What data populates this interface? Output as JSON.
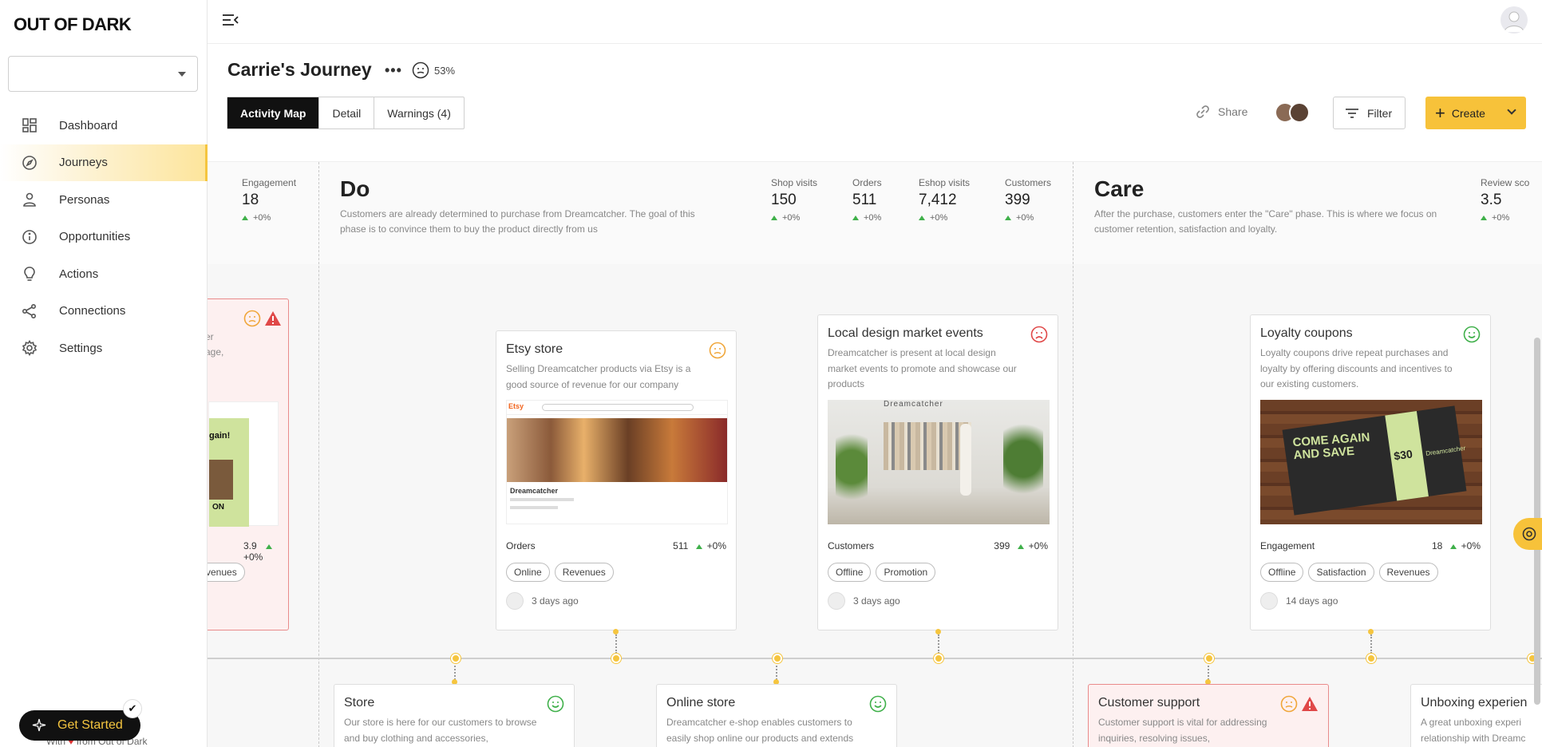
{
  "app": {
    "logo": "OUT OF DARK",
    "workspace_value": ""
  },
  "sidebar": {
    "items": [
      {
        "label": "Dashboard",
        "icon": "dashboard-icon"
      },
      {
        "label": "Journeys",
        "icon": "compass-icon",
        "active": true
      },
      {
        "label": "Personas",
        "icon": "person-icon"
      },
      {
        "label": "Opportunities",
        "icon": "info-icon"
      },
      {
        "label": "Actions",
        "icon": "lightbulb-icon"
      },
      {
        "label": "Connections",
        "icon": "share-nodes-icon"
      },
      {
        "label": "Settings",
        "icon": "gear-icon"
      }
    ],
    "get_started": "Get Started",
    "footer_prefix": "With",
    "footer_suffix": "from Out of Dark"
  },
  "header": {
    "title": "Carrie's Journey",
    "more": "•••",
    "mood_percent": "53%",
    "tabs": [
      "Activity Map",
      "Detail",
      "Warnings (4)"
    ],
    "share_label": "Share",
    "filter_label": "Filter",
    "create_label": "Create"
  },
  "stages": {
    "prev_metric": {
      "label": "Engagement",
      "value": "18",
      "delta": "+0%"
    },
    "do": {
      "title": "Do",
      "description": "Customers are already determined to purchase from Dreamcatcher. The goal of this phase is to convince them to buy the product directly from us",
      "metrics": [
        {
          "label": "Shop visits",
          "value": "150",
          "delta": "+0%"
        },
        {
          "label": "Orders",
          "value": "511",
          "delta": "+0%"
        },
        {
          "label": "Eshop visits",
          "value": "7,412",
          "delta": "+0%"
        },
        {
          "label": "Customers",
          "value": "399",
          "delta": "+0%"
        }
      ]
    },
    "care": {
      "title": "Care",
      "description": "After the purchase, customers enter the \"Care\" phase. This is where we focus on customer retention, satisfaction and loyalty.",
      "metrics": [
        {
          "label": "Review sco",
          "value": "3.5",
          "delta": "+0%"
        }
      ]
    }
  },
  "cards": {
    "partial": {
      "desc_fragment_1": "er",
      "desc_fragment_2": "age,",
      "metric_value": "3.9",
      "metric_delta": "+0%",
      "tag": "venues",
      "img_text_1": "gain!",
      "img_text_2": "ON"
    },
    "etsy": {
      "title": "Etsy store",
      "description": "Selling Dreamcatcher products via Etsy is a good source of revenue for our company",
      "metric_label": "Orders",
      "metric_value": "511",
      "metric_delta": "+0%",
      "tags": [
        "Online",
        "Revenues"
      ],
      "ago": "3 days ago",
      "img_brand": "Etsy",
      "img_shop": "Dreamcatcher"
    },
    "market": {
      "title": "Local design market events",
      "description": "Dreamcatcher is present at local design market events to promote and showcase our products",
      "metric_label": "Customers",
      "metric_value": "399",
      "metric_delta": "+0%",
      "tags": [
        "Offline",
        "Promotion"
      ],
      "ago": "3 days ago",
      "img_sign": "Dreamcatcher"
    },
    "loyalty": {
      "title": "Loyalty coupons",
      "description": "Loyalty coupons drive repeat purchases and loyalty by offering discounts and incentives to our existing customers.",
      "metric_label": "Engagement",
      "metric_value": "18",
      "metric_delta": "+0%",
      "tags": [
        "Offline",
        "Satisfaction",
        "Revenues"
      ],
      "ago": "14 days ago",
      "coupon_headline": "COME AGAIN AND SAVE",
      "coupon_amount": "$30",
      "coupon_brand": "Dreamcatcher"
    },
    "store": {
      "title": "Store",
      "description": "Our store is here for our customers to browse and buy clothing and accessories,"
    },
    "online_store": {
      "title": "Online store",
      "description": "Dreamcatcher e-shop enables customers to easily shop online our products and extends"
    },
    "support": {
      "title": "Customer support",
      "description": "Customer support is vital for addressing inquiries, resolving issues,"
    },
    "unboxing": {
      "title": "Unboxing experien",
      "description": "A great unboxing experi relationship with Dreamc"
    }
  },
  "colors": {
    "accent": "#f7c23a",
    "positive": "#3fb04a",
    "negative": "#e04848",
    "neutral_face": "#f0a63a"
  }
}
